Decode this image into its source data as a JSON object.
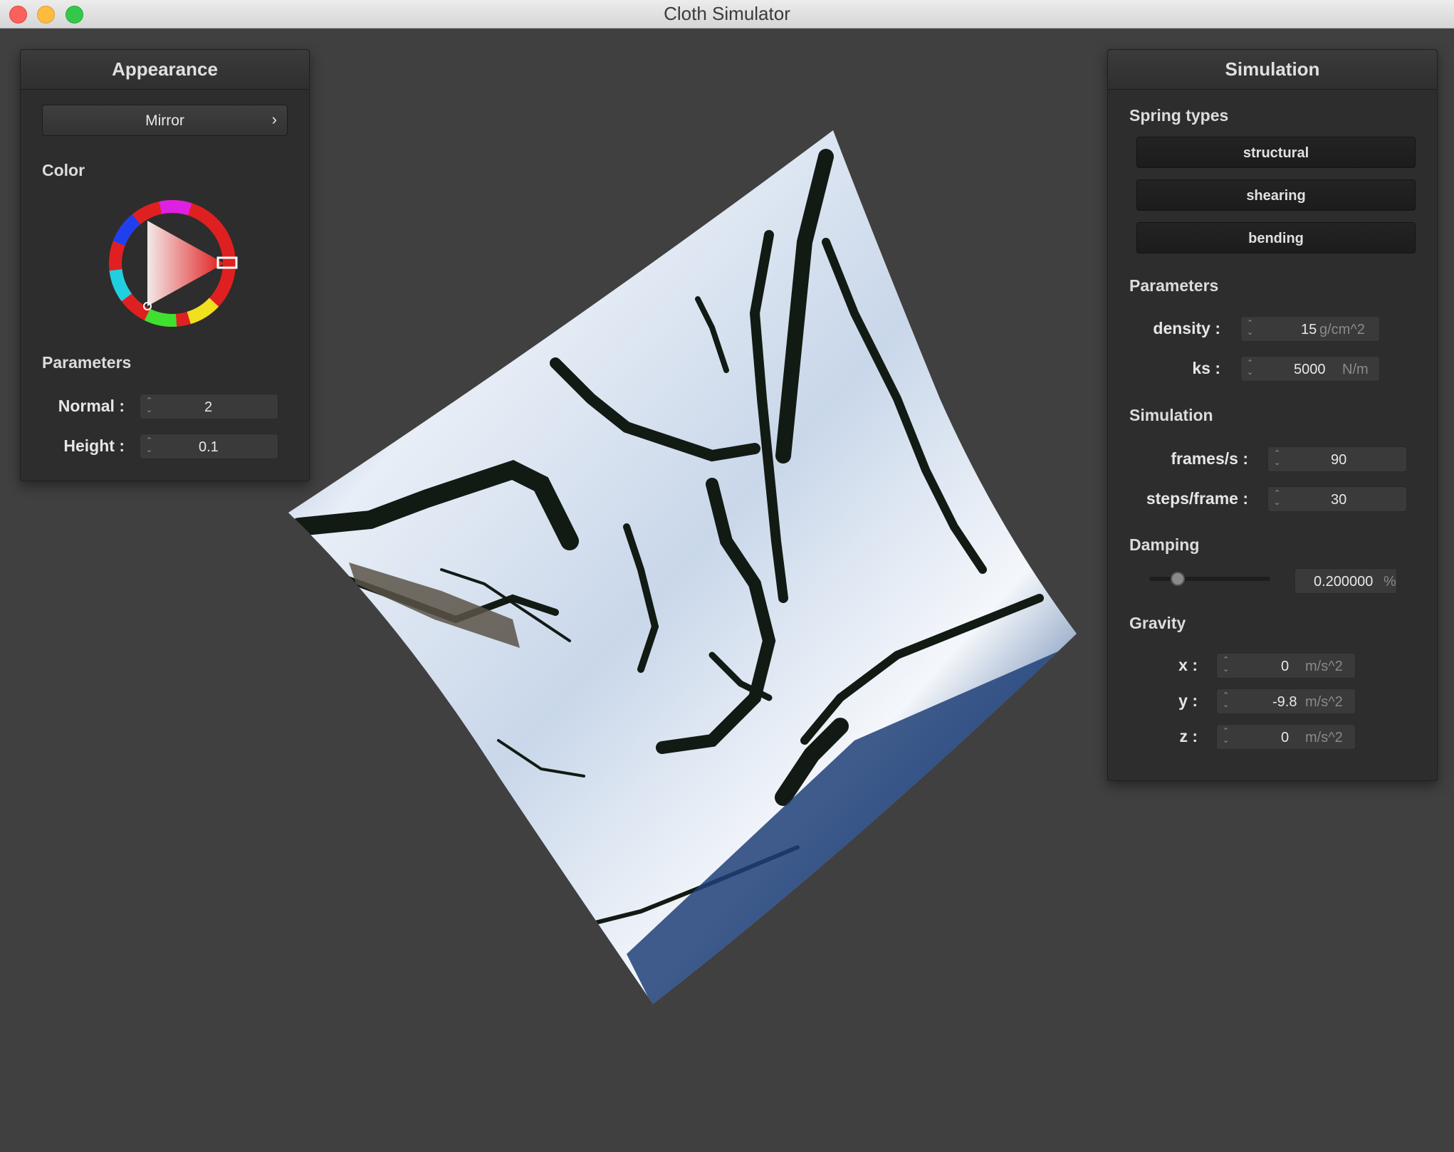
{
  "window": {
    "title": "Cloth Simulator"
  },
  "appearance": {
    "title": "Appearance",
    "shader_selected": "Mirror",
    "shader_chevron": "›",
    "color_label": "Color",
    "color_value": "#e8231b",
    "parameters_label": "Parameters",
    "normal_label": "Normal :",
    "normal_value": "2",
    "height_label": "Height :",
    "height_value": "0.1"
  },
  "simulation": {
    "title": "Simulation",
    "spring_types_label": "Spring types",
    "spring_buttons": [
      "structural",
      "shearing",
      "bending"
    ],
    "parameters_label": "Parameters",
    "density_label": "density :",
    "density_value": "15",
    "density_unit": "g/cm^2",
    "ks_label": "ks :",
    "ks_value": "5000",
    "ks_unit": "N/m",
    "simulation_label": "Simulation",
    "fps_label": "frames/s :",
    "fps_value": "90",
    "steps_label": "steps/frame :",
    "steps_value": "30",
    "damping_label": "Damping",
    "damping_value": "0.200000",
    "damping_unit": "%",
    "damping_slider_fraction": 0.2,
    "gravity_label": "Gravity",
    "gx_label": "x :",
    "gx_value": "0",
    "gy_label": "y :",
    "gy_value": "-9.8",
    "gz_label": "z :",
    "gz_value": "0",
    "gravity_unit": "m/s^2"
  }
}
